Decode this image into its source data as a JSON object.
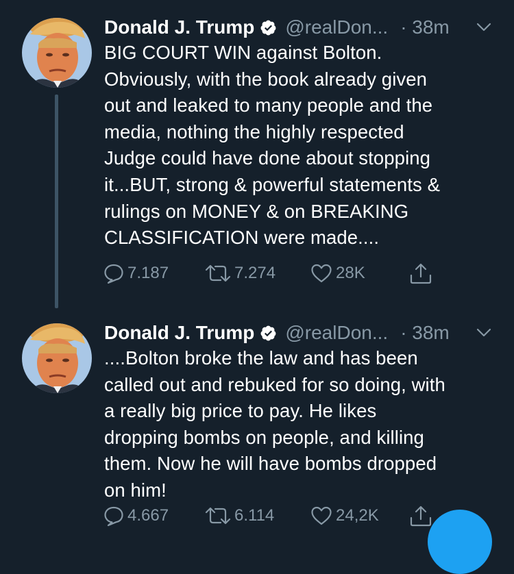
{
  "thread": [
    {
      "author": {
        "name": "Donald J. Trump",
        "handle": "@realDon...",
        "time": "· 38m",
        "verified": true
      },
      "text": "BIG COURT WIN against Bolton.\nObviously, with the book already given\nout and leaked to many people and the\nmedia, nothing the highly respected\nJudge could have done about stopping\nit...BUT, strong & powerful statements &\nrulings on MONEY & on BREAKING\nCLASSIFICATION were made....",
      "stats": {
        "replies": "7.187",
        "retweets": "7.274",
        "likes": "28K"
      }
    },
    {
      "author": {
        "name": "Donald J. Trump",
        "handle": "@realDon...",
        "time": "· 38m",
        "verified": true
      },
      "text": "....Bolton broke the law and has been\ncalled out and rebuked for so doing, with\na really big price to pay. He likes\ndropping bombs on people, and killing\nthem. Now he will have bombs dropped\non him!",
      "stats": {
        "replies": "4.667",
        "retweets": "6.114",
        "likes": "24,2K"
      }
    }
  ],
  "icons": {
    "reply": "speech-bubble-icon",
    "retweet": "retweet-arrows-icon",
    "like": "heart-icon",
    "share": "share-upload-icon",
    "verified": "verified-badge-icon",
    "more": "chevron-down-icon",
    "compose": "compose-fab"
  },
  "colors": {
    "background": "#15202b",
    "text": "#ffffff",
    "secondary": "#8899a6",
    "thread_line": "#3d5466",
    "accent": "#1da1f2"
  }
}
